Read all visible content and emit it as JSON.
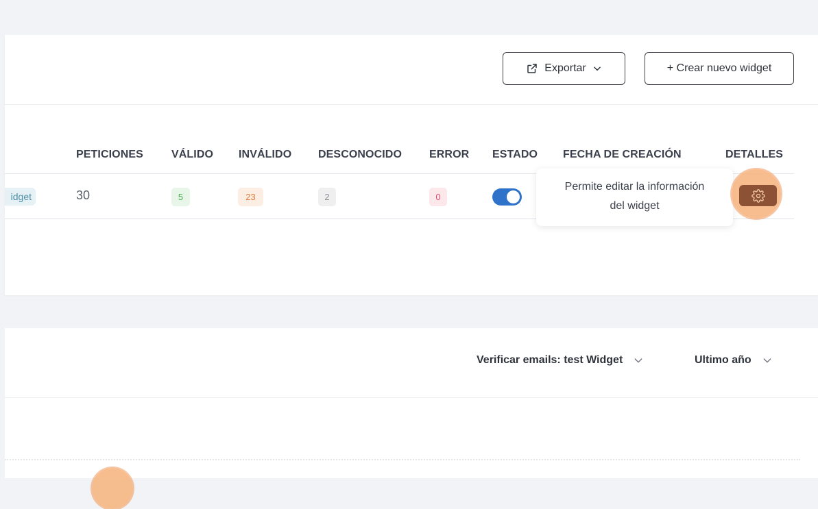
{
  "toolbar": {
    "export_label": "Exportar",
    "create_label": "+ Crear nuevo widget"
  },
  "table": {
    "columns": [
      "PETICIONES",
      "VÁLIDO",
      "INVÁLIDO",
      "DESCONOCIDO",
      "ERROR",
      "ESTADO",
      "FECHA DE CREACIÓN",
      "DETALLES"
    ],
    "rows": [
      {
        "name": "idget",
        "requests": "30",
        "valid": "5",
        "invalid": "23",
        "unknown": "2",
        "error": "0",
        "status_enabled": true
      }
    ]
  },
  "tooltip": {
    "line1": "Permite editar la información",
    "line2": "del widget"
  },
  "chart_filters": {
    "widget_select": "Verificar emails: test Widget",
    "period_select": "Ultimo año"
  },
  "icons": {
    "export": "external-link-icon",
    "settings": "gear-icon",
    "dropdown": "chevron-down-icon"
  },
  "colors": {
    "toggle_on": "#2f72c9",
    "settings_button": "#8d5236",
    "highlight": "#f6b27a",
    "valid": "#4caf50",
    "invalid": "#e27b3c",
    "error": "#e0506b"
  }
}
